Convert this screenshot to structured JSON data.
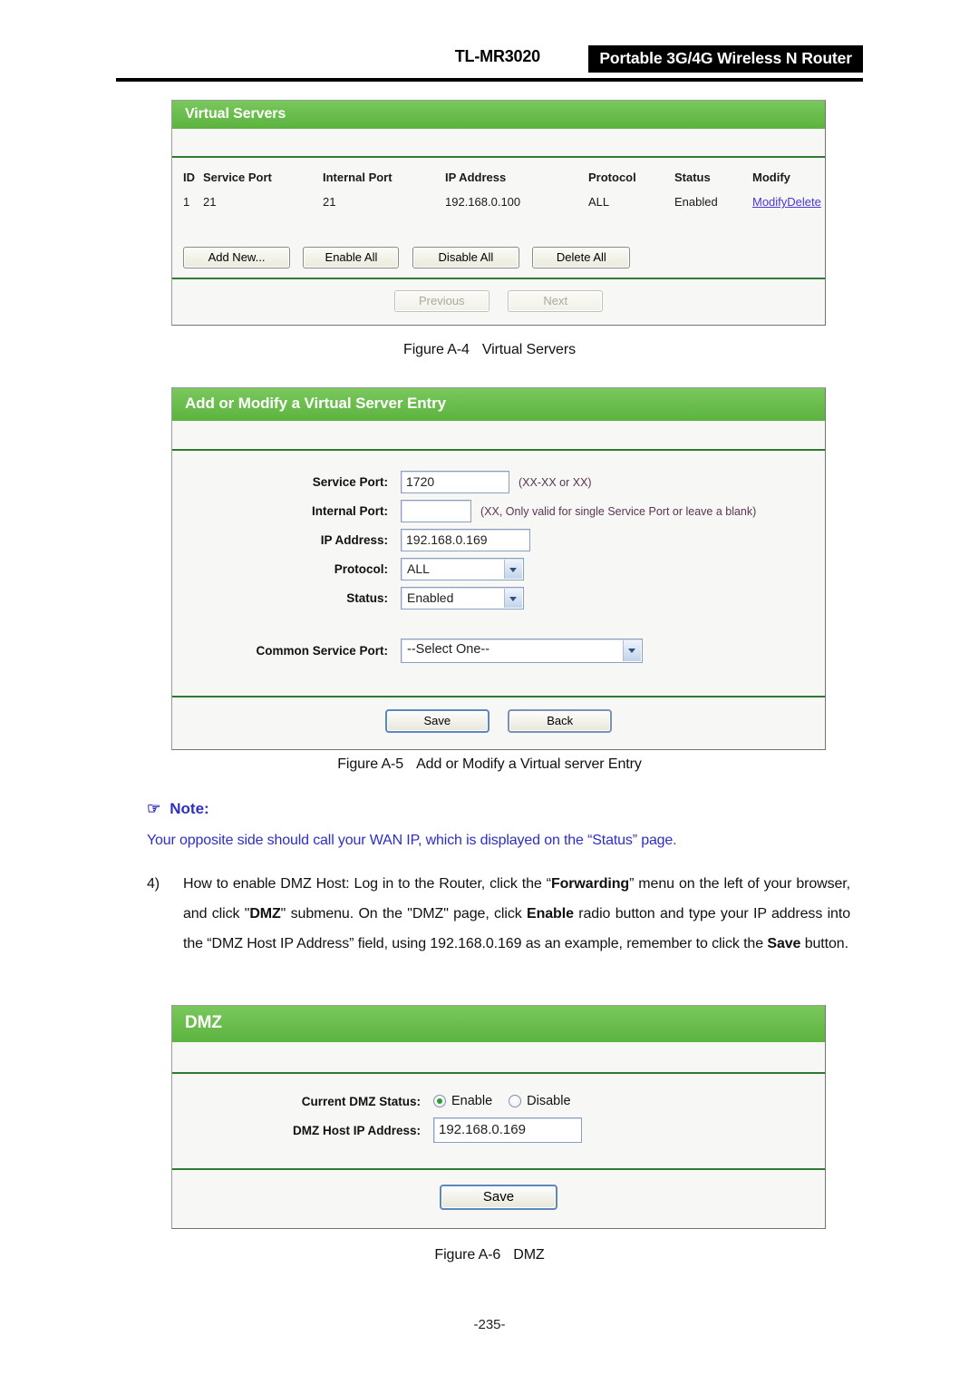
{
  "header": {
    "model": "TL-MR3020",
    "product": "Portable 3G/4G Wireless N Router"
  },
  "virtual_servers_panel": {
    "title": "Virtual Servers",
    "columns": [
      "ID",
      "Service Port",
      "Internal Port",
      "IP Address",
      "Protocol",
      "Status",
      "Modify"
    ],
    "rows": [
      {
        "id": "1",
        "service_port": "21",
        "internal_port": "21",
        "ip_address": "192.168.0.100",
        "protocol": "ALL",
        "status": "Enabled",
        "modify_link": "Modify",
        "delete_link": "Delete"
      }
    ],
    "buttons": {
      "add_new": "Add New...",
      "enable_all": "Enable All",
      "disable_all": "Disable All",
      "delete_all": "Delete All"
    },
    "pager": {
      "previous": "Previous",
      "next": "Next"
    }
  },
  "figure_a4": {
    "number": "Figure A-4",
    "title": "Virtual Servers"
  },
  "add_modify_panel": {
    "title": "Add or Modify a Virtual Server Entry",
    "fields": {
      "service_port_label": "Service Port:",
      "service_port_value": "1720",
      "service_port_hint": "(XX-XX or XX)",
      "internal_port_label": "Internal Port:",
      "internal_port_value": "",
      "internal_port_hint": "(XX, Only valid for single Service Port or leave a blank)",
      "ip_address_label": "IP Address:",
      "ip_address_value": "192.168.0.169",
      "protocol_label": "Protocol:",
      "protocol_value": "ALL",
      "status_label": "Status:",
      "status_value": "Enabled",
      "common_service_port_label": "Common Service Port:",
      "common_service_port_value": "--Select One--"
    },
    "buttons": {
      "save": "Save",
      "back": "Back"
    }
  },
  "figure_a5": {
    "number": "Figure A-5",
    "title": "Add or Modify a Virtual server Entry"
  },
  "note": {
    "icon": "pointing-hand",
    "heading": "Note:",
    "body": "Your opposite side should call your WAN IP, which is displayed on the “Status” page."
  },
  "instruction": {
    "marker": "4)",
    "line1_a": "How to enable DMZ Host: Log in to the Router, click the “",
    "line1_bold": "Forwarding",
    "line1_b": "” menu on the left",
    "line2_a": "of your browser, and click \"",
    "line2_bold1": "DMZ",
    "line2_b": "\" submenu. On the \"DMZ\" page, click ",
    "line2_bold2": "Enable",
    "line2_c": " radio",
    "line3": "button and type your IP address into the “DMZ Host IP Address” field, using",
    "line4_a": "192.168.0.169 as an example, remember to click the ",
    "line4_bold": "Save",
    "line4_b": " button."
  },
  "dmz_panel": {
    "title": "DMZ",
    "status_label": "Current DMZ Status:",
    "enable_label": "Enable",
    "disable_label": "Disable",
    "selected_status": "Enable",
    "host_ip_label": "DMZ Host IP Address:",
    "host_ip_value": "192.168.0.169",
    "save_button": "Save"
  },
  "figure_a6": {
    "number": "Figure A-6",
    "title": "DMZ"
  },
  "footer": {
    "page_number": "-235-"
  },
  "colors": {
    "panel_green": "#62bb46",
    "separator_green": "#2f7a33",
    "link_blue": "#4a37d6",
    "note_blue": "#2e2ec4",
    "radio_dot_green": "#2f9b2f"
  }
}
